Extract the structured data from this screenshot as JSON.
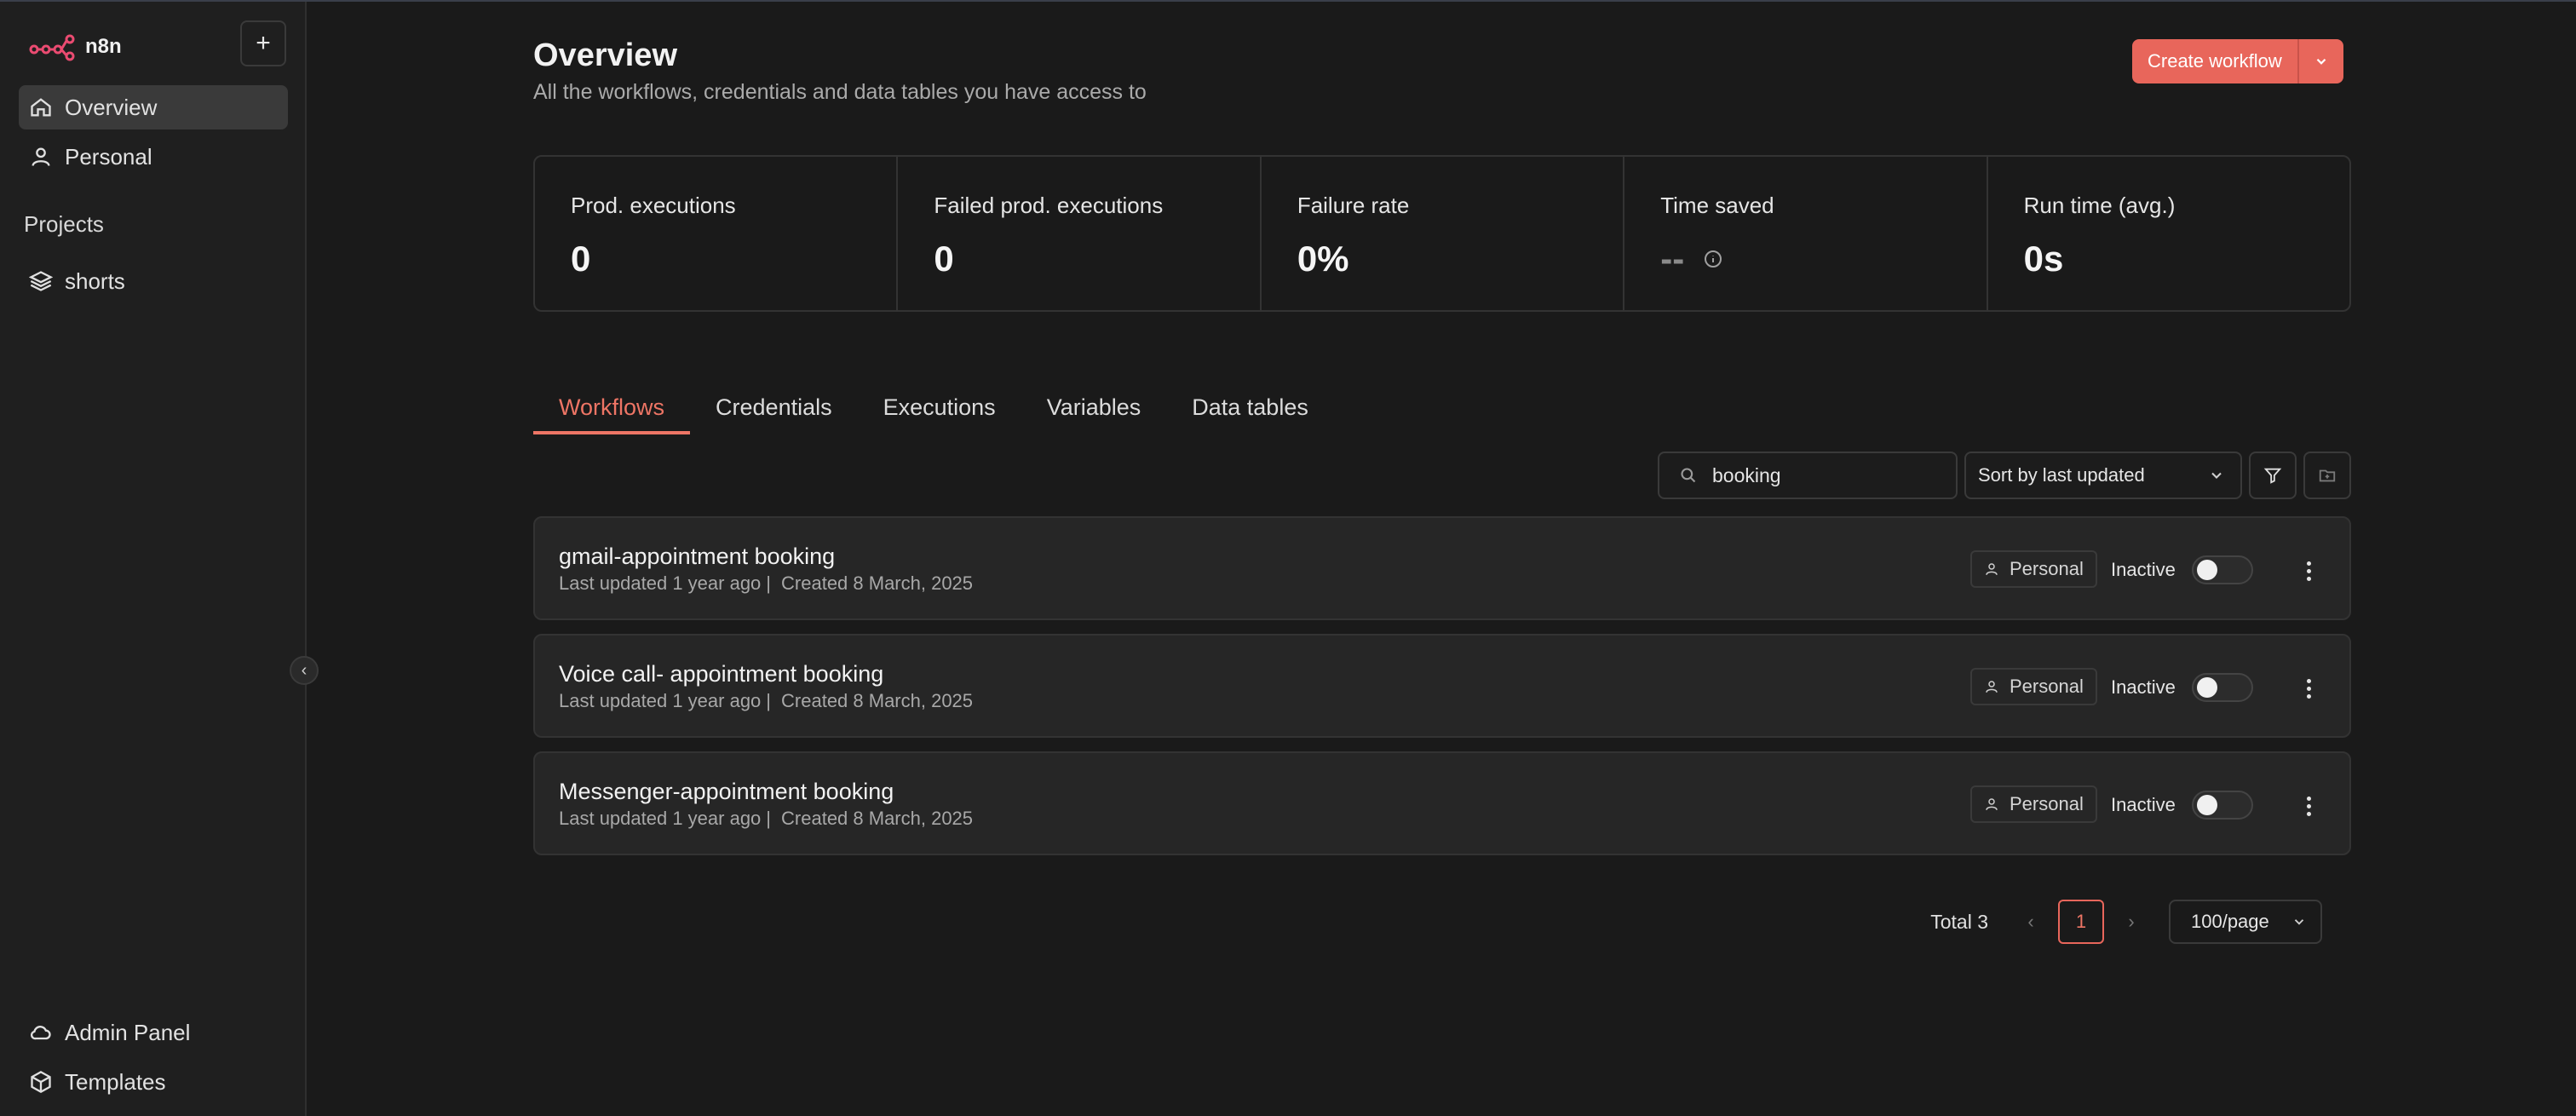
{
  "app": {
    "name": "n8n"
  },
  "sidebar": {
    "items": [
      {
        "label": "Overview",
        "icon": "home-icon",
        "active": true
      },
      {
        "label": "Personal",
        "icon": "user-icon",
        "active": false
      }
    ],
    "projects_title": "Projects",
    "projects": [
      {
        "label": "shorts",
        "icon": "layers-icon"
      }
    ],
    "footer": [
      {
        "label": "Admin Panel",
        "icon": "cloud-icon"
      },
      {
        "label": "Templates",
        "icon": "box-icon"
      }
    ]
  },
  "header": {
    "title": "Overview",
    "subtitle": "All the workflows, credentials and data tables you have access to",
    "create_label": "Create workflow"
  },
  "stats": [
    {
      "label": "Prod. executions",
      "value": "0"
    },
    {
      "label": "Failed prod. executions",
      "value": "0"
    },
    {
      "label": "Failure rate",
      "value": "0%"
    },
    {
      "label": "Time saved",
      "value": "--"
    },
    {
      "label": "Run time (avg.)",
      "value": "0s"
    }
  ],
  "tabs": [
    {
      "label": "Workflows",
      "active": true
    },
    {
      "label": "Credentials"
    },
    {
      "label": "Executions"
    },
    {
      "label": "Variables"
    },
    {
      "label": "Data tables"
    }
  ],
  "toolbar": {
    "search_value": "booking",
    "sort_value": "Sort by last updated"
  },
  "workflows": [
    {
      "name": "gmail-appointment booking",
      "updated": "Last updated 1 year ago",
      "created": "Created 8 March, 2025",
      "owner": "Personal",
      "status": "Inactive"
    },
    {
      "name": "Voice call- appointment booking",
      "updated": "Last updated 1 year ago",
      "created": "Created 8 March, 2025",
      "owner": "Personal",
      "status": "Inactive"
    },
    {
      "name": "Messenger-appointment booking",
      "updated": "Last updated 1 year ago",
      "created": "Created 8 March, 2025",
      "owner": "Personal",
      "status": "Inactive"
    }
  ],
  "pagination": {
    "total_label": "Total 3",
    "current_page": "1",
    "per_page": "100/page"
  },
  "colors": {
    "accent": "#e8665b",
    "background": "#1a1a1a",
    "sidebar": "#1f1f1f",
    "card": "#262626"
  }
}
